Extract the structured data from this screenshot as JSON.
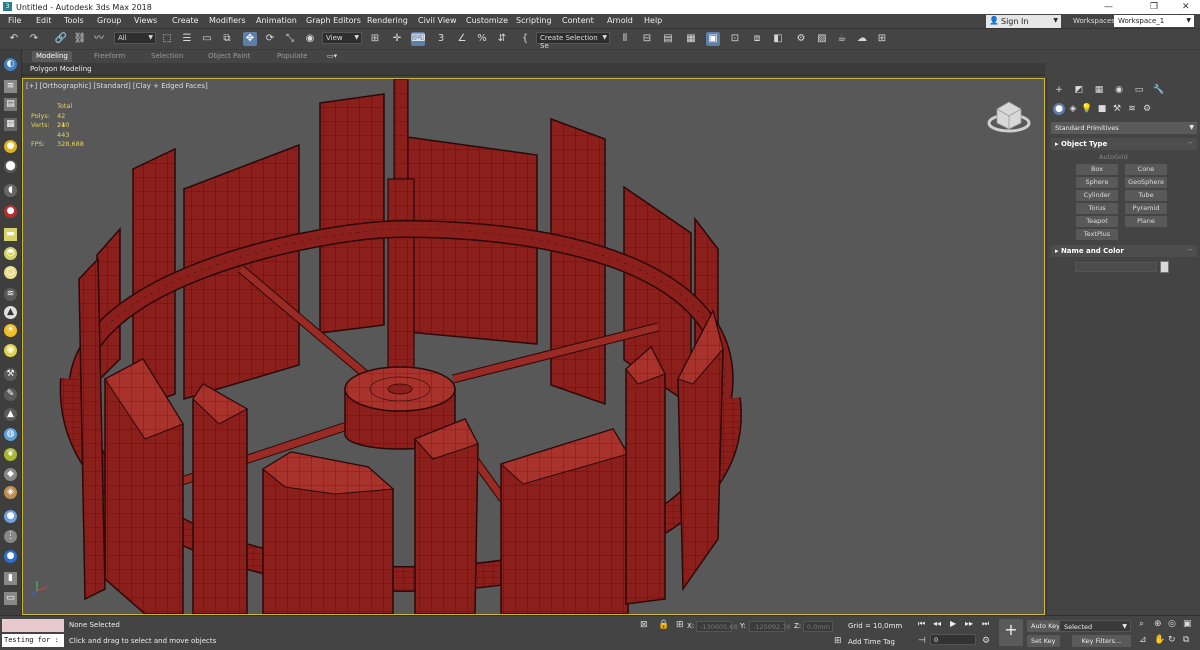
{
  "window": {
    "title": "Untitled - Autodesk 3ds Max 2018",
    "logo": "3",
    "minimize": "—",
    "maximize": "❐",
    "close": "✕"
  },
  "menu": [
    "File",
    "Edit",
    "Tools",
    "Group",
    "Views",
    "Create",
    "Modifiers",
    "Animation",
    "Graph Editors",
    "Rendering",
    "Civil View",
    "Customize",
    "Scripting",
    "Content",
    "Arnold",
    "Help"
  ],
  "signin": {
    "label": "Sign In"
  },
  "workspaces": {
    "label": "Workspaces:",
    "value": "Workspace_1"
  },
  "toolbar": {
    "filter": "All",
    "refcoord": "View",
    "selset": "Create Selection Se"
  },
  "ribbon": {
    "tabs": [
      "Modeling",
      "Freeform",
      "Selection",
      "Object Paint",
      "Populate"
    ],
    "active": "Modeling",
    "subpanel": "Polygon Modeling"
  },
  "viewport": {
    "label": "[+] [Orthographic] [Standard] [Clay + Edged Faces]",
    "stats": {
      "total": "Total",
      "polys_label": "Polys:",
      "polys": "42 240",
      "verts_label": "Verts:",
      "verts": "21 443",
      "fps_label": "FPS:",
      "fps": "328,688"
    },
    "colors": {
      "model": "#8b1f1c",
      "model_light": "#a8322c",
      "wire": "#2a0908",
      "bg": "#585858",
      "border": "#c9b53a"
    }
  },
  "command_panel": {
    "dropdown": "Standard Primitives",
    "object_type": {
      "title": "Object Type",
      "autogrid": "AutoGrid",
      "buttons": [
        "Box",
        "Cone",
        "Sphere",
        "GeoSphere",
        "Cylinder",
        "Tube",
        "Torus",
        "Pyramid",
        "Teapot",
        "Plane",
        "TextPlus"
      ]
    },
    "name_color": {
      "title": "Name and Color"
    },
    "collapse": "−"
  },
  "status": {
    "script_input": "Testing for :",
    "selection": "None Selected",
    "prompt": "Click and drag to select and move objects",
    "x_label": "X:",
    "x_value": "-130605,68",
    "y_label": "Y:",
    "y_value": "-125092,76",
    "z_label": "Z:",
    "z_value": "0,0mm",
    "grid": "Grid = 10,0mm",
    "add_time_tag": "Add Time Tag",
    "frame": "0",
    "autokey": "Auto Key",
    "setkey": "Set Key",
    "selected": "Selected",
    "keyfilters": "Key Filters..."
  }
}
